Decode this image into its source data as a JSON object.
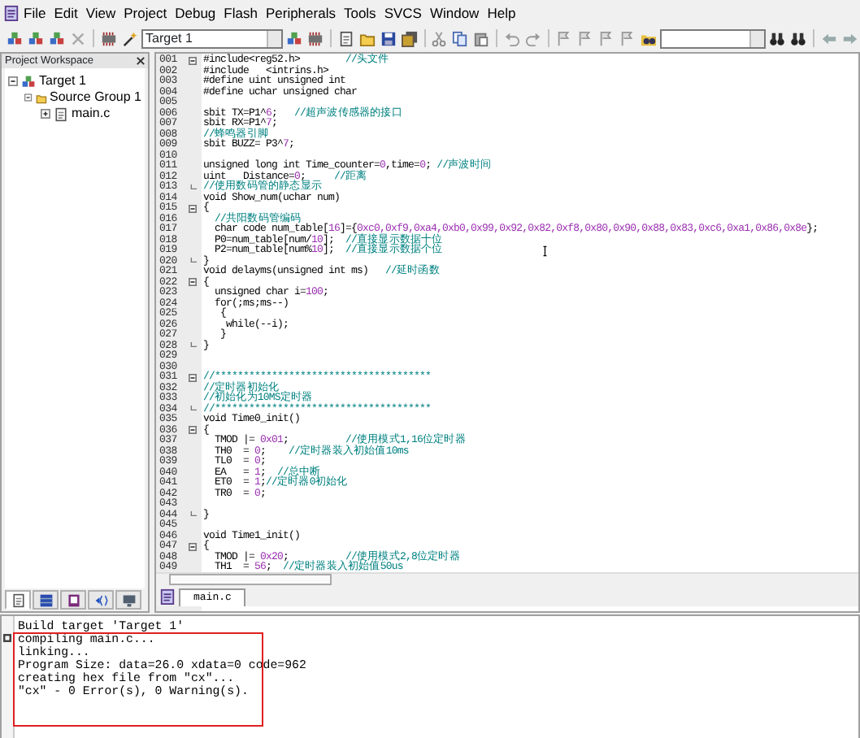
{
  "menu": [
    "File",
    "Edit",
    "View",
    "Project",
    "Debug",
    "Flash",
    "Peripherals",
    "Tools",
    "SVCS",
    "Window",
    "Help"
  ],
  "toolbar": {
    "target": "Target 1"
  },
  "workspace": {
    "title": "Project Workspace",
    "tree": [
      {
        "label": "Target 1",
        "expanded": true,
        "children": [
          {
            "label": "Source Group 1",
            "expanded": true,
            "children": [
              {
                "label": "main.c",
                "expanded": false
              }
            ]
          }
        ]
      }
    ],
    "tabs": [
      {
        "kind": "files",
        "selected": true
      },
      {
        "kind": "registers",
        "selected": false
      },
      {
        "kind": "books",
        "selected": false
      },
      {
        "kind": "functions",
        "selected": false
      },
      {
        "kind": "templates",
        "selected": false
      }
    ]
  },
  "editor": {
    "lines": [
      {
        "number": "001",
        "fold_open": true,
        "segments": [
          {
            "kind": "code",
            "text": "#include<reg52.h>        "
          },
          {
            "kind": "comment",
            "text": "//头文件"
          }
        ]
      },
      {
        "number": "002",
        "segments": [
          {
            "kind": "code",
            "text": "#include   <intrins.h>"
          }
        ]
      },
      {
        "number": "003",
        "segments": [
          {
            "kind": "code",
            "text": "#define uint unsigned int"
          }
        ]
      },
      {
        "number": "004",
        "segments": [
          {
            "kind": "code",
            "text": "#define uchar unsigned char"
          }
        ]
      },
      {
        "number": "005"
      },
      {
        "number": "006",
        "segments": [
          {
            "kind": "code",
            "text": "sbit TX=P1^"
          },
          {
            "kind": "number",
            "text": "6"
          },
          {
            "kind": "code",
            "text": ";   "
          },
          {
            "kind": "comment",
            "text": "//超声波传感器的接口"
          }
        ]
      },
      {
        "number": "007",
        "segments": [
          {
            "kind": "code",
            "text": "sbit RX=P1^"
          },
          {
            "kind": "number",
            "text": "7"
          },
          {
            "kind": "code",
            "text": ";"
          }
        ]
      },
      {
        "number": "008",
        "segments": [
          {
            "kind": "comment",
            "text": "//蜂鸣器引脚"
          }
        ]
      },
      {
        "number": "009",
        "segments": [
          {
            "kind": "code",
            "text": "sbit BUZZ= P3^"
          },
          {
            "kind": "number",
            "text": "7"
          },
          {
            "kind": "code",
            "text": ";"
          }
        ]
      },
      {
        "number": "010"
      },
      {
        "number": "011",
        "segments": [
          {
            "kind": "code",
            "text": "unsigned long int Time_counter="
          },
          {
            "kind": "number",
            "text": "0"
          },
          {
            "kind": "code",
            "text": ",time="
          },
          {
            "kind": "number",
            "text": "0"
          },
          {
            "kind": "code",
            "text": "; "
          },
          {
            "kind": "comment",
            "text": "//声波时间"
          }
        ]
      },
      {
        "number": "012",
        "segments": [
          {
            "kind": "code",
            "text": "uint   Distance="
          },
          {
            "kind": "number",
            "text": "0"
          },
          {
            "kind": "code",
            "text": ";     "
          },
          {
            "kind": "comment",
            "text": "//距离"
          }
        ]
      },
      {
        "number": "013",
        "fold_end": true,
        "segments": [
          {
            "kind": "comment",
            "text": "//使用数码管的静态显示"
          }
        ]
      },
      {
        "number": "014",
        "segments": [
          {
            "kind": "code",
            "text": "void Show_num(uchar num)"
          }
        ]
      },
      {
        "number": "015",
        "fold_open": true,
        "segments": [
          {
            "kind": "code",
            "text": "{"
          }
        ]
      },
      {
        "number": "016",
        "segments": [
          {
            "kind": "comment",
            "text": "  //共阳数码管编码"
          }
        ]
      },
      {
        "number": "017",
        "segments": [
          {
            "kind": "code",
            "text": "  char code num_table["
          },
          {
            "kind": "number",
            "text": "16"
          },
          {
            "kind": "code",
            "text": "]={"
          },
          {
            "kind": "number",
            "text": "0xc0,0xf9,0xa4,0xb0,0x99,0x92,0x82,0xf8,0x80,0x90,0x88,0x83,0xc6,0xa1,0x86,0x8e"
          },
          {
            "kind": "code",
            "text": "};"
          }
        ]
      },
      {
        "number": "018",
        "segments": [
          {
            "kind": "code",
            "text": "  P0=num_table[num/"
          },
          {
            "kind": "number",
            "text": "10"
          },
          {
            "kind": "code",
            "text": "];  "
          },
          {
            "kind": "comment",
            "text": "//直接显示数据十位"
          }
        ]
      },
      {
        "number": "019",
        "segments": [
          {
            "kind": "code",
            "text": "  P2=num_table[num%"
          },
          {
            "kind": "number",
            "text": "10"
          },
          {
            "kind": "code",
            "text": "];  "
          },
          {
            "kind": "comment",
            "text": "//直接显示数据个位"
          }
        ]
      },
      {
        "number": "020",
        "fold_end": true,
        "segments": [
          {
            "kind": "code",
            "text": "}"
          }
        ]
      },
      {
        "number": "021",
        "segments": [
          {
            "kind": "code",
            "text": "void delayms(unsigned int ms)   "
          },
          {
            "kind": "comment",
            "text": "//延时函数"
          }
        ]
      },
      {
        "number": "022",
        "fold_open": true,
        "segments": [
          {
            "kind": "code",
            "text": "{"
          }
        ]
      },
      {
        "number": "023",
        "segments": [
          {
            "kind": "code",
            "text": "  unsigned char i="
          },
          {
            "kind": "number",
            "text": "100"
          },
          {
            "kind": "code",
            "text": ";"
          }
        ]
      },
      {
        "number": "024",
        "segments": [
          {
            "kind": "code",
            "text": "  for(;ms;ms--)"
          }
        ]
      },
      {
        "number": "025",
        "segments": [
          {
            "kind": "code",
            "text": "   {"
          }
        ]
      },
      {
        "number": "026",
        "segments": [
          {
            "kind": "code",
            "text": "    while(--i);"
          }
        ]
      },
      {
        "number": "027",
        "segments": [
          {
            "kind": "code",
            "text": "   }"
          }
        ]
      },
      {
        "number": "028",
        "fold_end": true,
        "segments": [
          {
            "kind": "code",
            "text": "}"
          }
        ]
      },
      {
        "number": "029"
      },
      {
        "number": "030"
      },
      {
        "number": "031",
        "fold_open": true,
        "segments": [
          {
            "kind": "comment",
            "text": "//**************************************"
          }
        ]
      },
      {
        "number": "032",
        "segments": [
          {
            "kind": "comment",
            "text": "//定时器初始化"
          }
        ]
      },
      {
        "number": "033",
        "segments": [
          {
            "kind": "comment",
            "text": "//初始化为10MS定时器"
          }
        ]
      },
      {
        "number": "034",
        "fold_end": true,
        "segments": [
          {
            "kind": "comment",
            "text": "//**************************************"
          }
        ]
      },
      {
        "number": "035",
        "segments": [
          {
            "kind": "code",
            "text": "void Time0_init()"
          }
        ]
      },
      {
        "number": "036",
        "fold_open": true,
        "segments": [
          {
            "kind": "code",
            "text": "{"
          }
        ]
      },
      {
        "number": "037",
        "segments": [
          {
            "kind": "code",
            "text": "  TMOD |= "
          },
          {
            "kind": "number",
            "text": "0x01"
          },
          {
            "kind": "code",
            "text": ";          "
          },
          {
            "kind": "comment",
            "text": "//使用模式1,16位定时器"
          }
        ]
      },
      {
        "number": "038",
        "segments": [
          {
            "kind": "code",
            "text": "  TH0  = "
          },
          {
            "kind": "number",
            "text": "0"
          },
          {
            "kind": "code",
            "text": ";    "
          },
          {
            "kind": "comment",
            "text": "//定时器装入初始值10ms"
          }
        ]
      },
      {
        "number": "039",
        "segments": [
          {
            "kind": "code",
            "text": "  TL0  = "
          },
          {
            "kind": "number",
            "text": "0"
          },
          {
            "kind": "code",
            "text": ";"
          }
        ]
      },
      {
        "number": "040",
        "segments": [
          {
            "kind": "code",
            "text": "  EA   = "
          },
          {
            "kind": "number",
            "text": "1"
          },
          {
            "kind": "code",
            "text": ";  "
          },
          {
            "kind": "comment",
            "text": "//总中断"
          }
        ]
      },
      {
        "number": "041",
        "segments": [
          {
            "kind": "code",
            "text": "  ET0  = "
          },
          {
            "kind": "number",
            "text": "1"
          },
          {
            "kind": "code",
            "text": ";"
          },
          {
            "kind": "comment",
            "text": "//定时器0初始化"
          }
        ]
      },
      {
        "number": "042",
        "segments": [
          {
            "kind": "code",
            "text": "  TR0  = "
          },
          {
            "kind": "number",
            "text": "0"
          },
          {
            "kind": "code",
            "text": ";"
          }
        ]
      },
      {
        "number": "043"
      },
      {
        "number": "044",
        "fold_end": true,
        "segments": [
          {
            "kind": "code",
            "text": "}"
          }
        ]
      },
      {
        "number": "045"
      },
      {
        "number": "046",
        "segments": [
          {
            "kind": "code",
            "text": "void Time1_init()"
          }
        ]
      },
      {
        "number": "047",
        "fold_open": true,
        "segments": [
          {
            "kind": "code",
            "text": "{"
          }
        ]
      },
      {
        "number": "048",
        "segments": [
          {
            "kind": "code",
            "text": "  TMOD |= "
          },
          {
            "kind": "number",
            "text": "0x20"
          },
          {
            "kind": "code",
            "text": ";          "
          },
          {
            "kind": "comment",
            "text": "//使用模式2,8位定时器"
          }
        ]
      },
      {
        "number": "049",
        "segments": [
          {
            "kind": "code",
            "text": "  TH1  = "
          },
          {
            "kind": "number",
            "text": "56"
          },
          {
            "kind": "code",
            "text": ";  "
          },
          {
            "kind": "comment",
            "text": "//定时器装入初始值50us"
          }
        ]
      }
    ],
    "tabs": [
      {
        "label": "main.c",
        "selected": true
      }
    ]
  },
  "build_output": {
    "lines": [
      "Build target 'Target 1'",
      "compiling main.c...",
      "linking...",
      "Program Size: data=26.0 xdata=0 code=962",
      "creating hex file from \"cx\"...",
      "\"cx\" - 0 Error(s), 0 Warning(s)."
    ]
  }
}
